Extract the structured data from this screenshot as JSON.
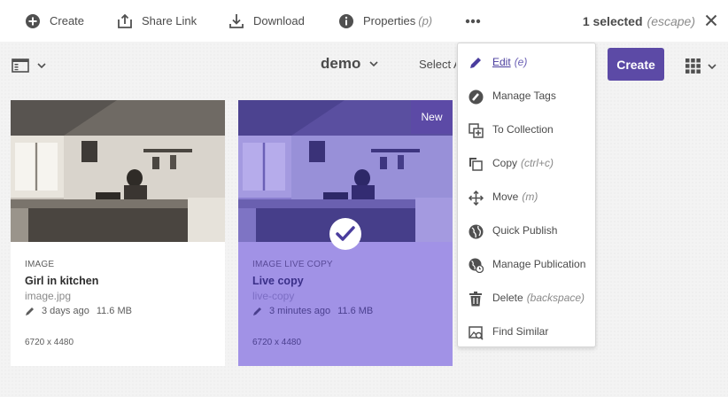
{
  "actionbar": {
    "create_label": "Create",
    "share_label": "Share Link",
    "download_label": "Download",
    "properties_label": "Properties",
    "properties_hint": "(p)",
    "more_icon": "ellipsis-icon",
    "selected_label": "1 selected",
    "selected_hint": "(escape)"
  },
  "toolbar": {
    "folder_title": "demo",
    "select_label": "Select All",
    "create_button": "Create"
  },
  "cards": [
    {
      "type": "IMAGE",
      "title": "Girl in kitchen",
      "name": "image.jpg",
      "modified": "3 days ago",
      "size": "11.6 MB",
      "dimensions": "6720 x 4480",
      "selected": false
    },
    {
      "type": "IMAGE LIVE COPY",
      "title": "Live copy",
      "name": "live-copy",
      "modified": "3 minutes ago",
      "size": "11.6 MB",
      "dimensions": "6720 x 4480",
      "badge": "New",
      "selected": true
    }
  ],
  "menu": {
    "items": [
      {
        "label": "Edit",
        "hint": "(e)",
        "icon": "pencil-icon"
      },
      {
        "label": "Manage Tags",
        "hint": "",
        "icon": "tag-icon"
      },
      {
        "label": "To Collection",
        "hint": "",
        "icon": "collection-icon"
      },
      {
        "label": "Copy",
        "hint": "(ctrl+c)",
        "icon": "copy-icon"
      },
      {
        "label": "Move",
        "hint": "(m)",
        "icon": "move-icon"
      },
      {
        "label": "Quick Publish",
        "hint": "",
        "icon": "globe-icon"
      },
      {
        "label": "Manage Publication",
        "hint": "",
        "icon": "globe-clock-icon"
      },
      {
        "label": "Delete",
        "hint": "(backspace)",
        "icon": "trash-icon"
      },
      {
        "label": "Find Similar",
        "hint": "",
        "icon": "find-similar-icon"
      }
    ]
  },
  "colors": {
    "accent": "#5c4aa6",
    "selected_card": "#a192e6",
    "text": "#4b4b4b"
  }
}
